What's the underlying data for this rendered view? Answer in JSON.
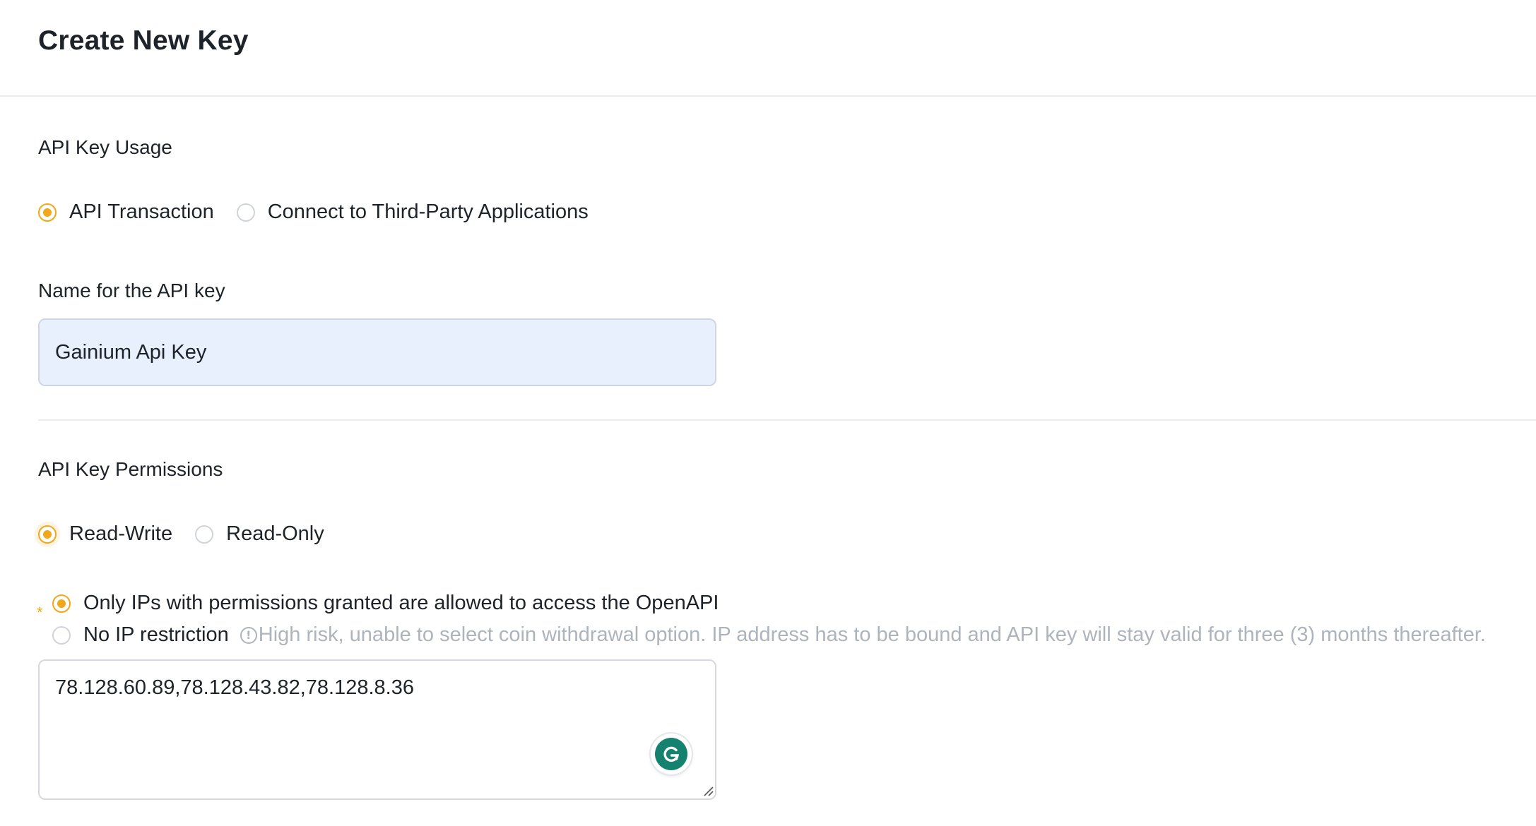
{
  "header": {
    "title": "Create New Key"
  },
  "usage": {
    "label": "API Key Usage",
    "options": [
      {
        "label": "API Transaction",
        "selected": true
      },
      {
        "label": "Connect to Third-Party Applications",
        "selected": false
      }
    ]
  },
  "name_field": {
    "label": "Name for the API key",
    "value": "Gainium Api Key"
  },
  "permissions": {
    "label": "API Key Permissions",
    "options": [
      {
        "label": "Read-Write",
        "selected": true
      },
      {
        "label": "Read-Only",
        "selected": false
      }
    ]
  },
  "ip_access": {
    "required_mark": "*",
    "options": [
      {
        "label": "Only IPs with permissions granted are allowed to access the OpenAPI",
        "selected": true
      },
      {
        "label": "No IP restriction",
        "selected": false
      }
    ],
    "warning_icon": "!",
    "warning": "High risk, unable to select coin withdrawal option. IP address has to be bound and API key will stay valid for three (3) months thereafter.",
    "ip_list": "78.128.60.89,78.128.43.82,78.128.8.36"
  },
  "colors": {
    "accent": "#f0a81a",
    "input_autofill_bg": "#e8f0fe",
    "grammarly": "#15826f",
    "muted_text": "#aeb4bc"
  },
  "icons": {
    "grammarly": "grammarly-icon",
    "info": "info-circle-icon",
    "resize": "resize-handle-icon"
  }
}
